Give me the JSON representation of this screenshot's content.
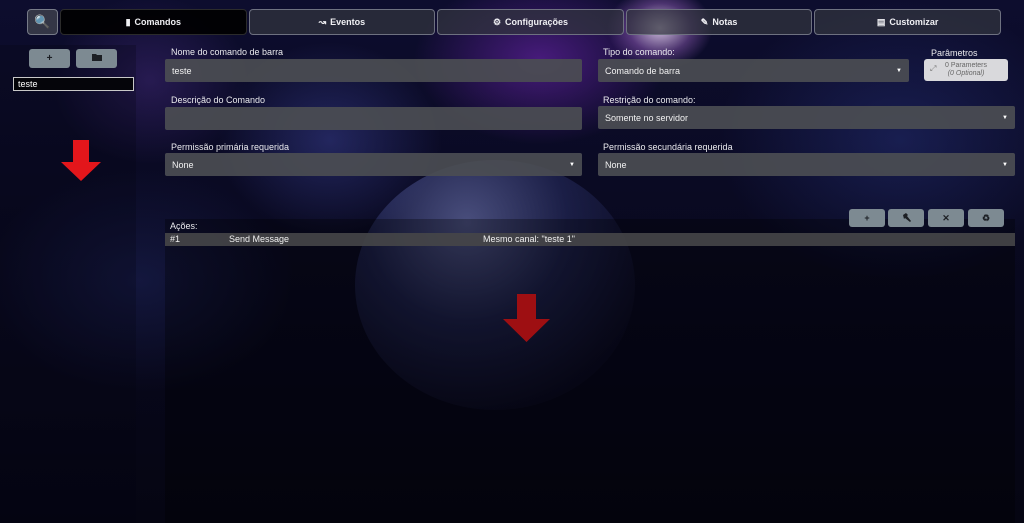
{
  "nav": {
    "tabs": [
      {
        "label": "Comandos",
        "icon": "book-icon"
      },
      {
        "label": "Eventos",
        "icon": "chart-icon"
      },
      {
        "label": "Configurações",
        "icon": "gears-icon"
      },
      {
        "label": "Notas",
        "icon": "pencil-icon"
      },
      {
        "label": "Customizar",
        "icon": "image-icon"
      }
    ],
    "active_tab": "Comandos"
  },
  "sidebar": {
    "tree_input_value": "teste"
  },
  "form": {
    "name_label": "Nome do comando de barra",
    "name_value": "teste",
    "type_label": "Tipo do comando:",
    "type_value": "Comando de barra",
    "params_label": "Parâmetros",
    "params_count": "0 Parameters",
    "params_optional": "(0 Optional)",
    "desc_label": "Descrição do Comando",
    "desc_value": "",
    "restriction_label": "Restrição do comando:",
    "restriction_value": "Somente no servidor",
    "primary_perm_label": "Permissão primária requerida",
    "primary_perm_value": "None",
    "secondary_perm_label": "Permissão secundária requerida",
    "secondary_perm_value": "None"
  },
  "actions": {
    "label": "Ações:",
    "rows": [
      {
        "index": "#1",
        "name": "Send Message",
        "detail": "Mesmo canal: \"teste 1\""
      }
    ]
  },
  "colors": {
    "annotation_arrow": "#e3161b",
    "button_gray": "#7d8a92",
    "field_bg": "#4b4d52"
  }
}
